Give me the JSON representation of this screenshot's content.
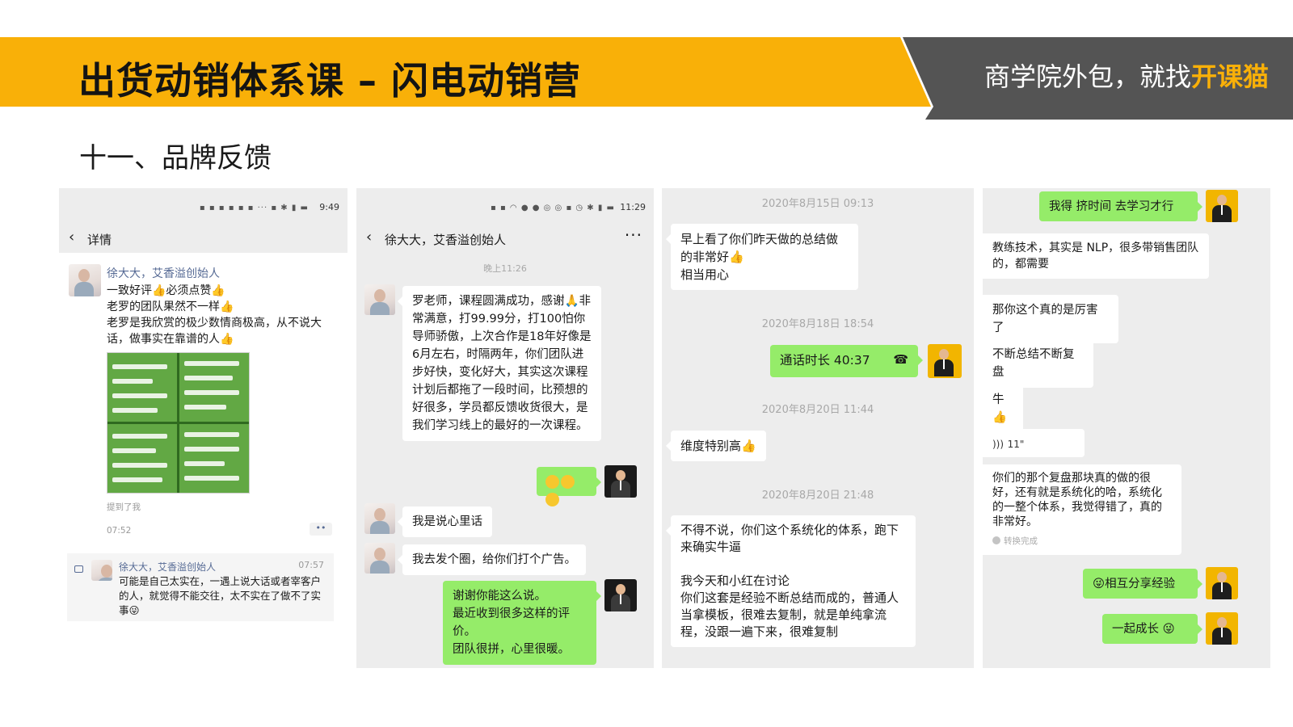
{
  "header": {
    "title": "出货动销体系课 – 闪电动销营",
    "slogan_prefix": "商学院外包，就找",
    "slogan_brand": "开课猫",
    "colors": {
      "yellow": "#f9b008",
      "gray": "#545454"
    }
  },
  "section_title": "十一、品牌反馈",
  "panel1": {
    "status_time": "9:49",
    "nav_title": "详情",
    "poster_name": "徐大大，艾香溢创始人",
    "post_lines": [
      "一致好评👍必须点赞👍",
      "老罗的团队果然不一样👍",
      "老罗是我欣赏的极少数情商极高，从不说大话，做事实在靠谱的人👍"
    ],
    "mention": "提到了我",
    "post_time": "07:52",
    "more_dots": "••",
    "comment": {
      "name": "徐大大，艾香溢创始人",
      "time": "07:57",
      "text": "可能是自己太实在，一遇上说大话或者宰客户的人，就觉得不能交往，太不实在了做不了实事😜"
    }
  },
  "panel2": {
    "status_time": "11:29",
    "nav_title": "徐大大，艾香溢创始人",
    "nav_more": "···",
    "time_label": "晚上11:26",
    "msg1": "罗老师，课程圆满成功，感谢🙏非常满意，打99.99分，打100怕你导师骄傲，上次合作是18年好像是6月左右，时隔两年，你们团队进步好快，变化好大，其实这次课程计划后都拖了一段时间，比预想的好很多，学员都反馈收货很大，是我们学习线上的最好的一次课程。",
    "msg2": "我是说心里话",
    "msg3": "我去发个圈，给你们打个广告。",
    "reply": "谢谢你能这么说。\n最近收到很多这样的评价。\n团队很拼，心里很暖。"
  },
  "panel3": {
    "ts1": "2020年8月15日 09:13",
    "msg1": "早上看了你们昨天做的总结做的非常好👍\n相当用心",
    "ts2": "2020年8月18日 18:54",
    "call": "通话时长 40:37",
    "ts3": "2020年8月20日 11:44",
    "msg2": "维度特别高👍",
    "ts4": "2020年8月20日 21:48",
    "msg3": "不得不说，你们这个系统化的体系，跑下来确实牛逼\n\n我今天和小红在讨论\n你们这套是经验不断总结而成的，普通人当拿模板，很难去复制，就是单纯拿流程，没跟一遍下来，很难复制"
  },
  "panel4": {
    "sent1": "我得 挤时间 去学习才行",
    "msg1": "教练技术，其实是 NLP，很多带销售团队的，都需要",
    "msg2": "那你这个真的是厉害了",
    "msg3": "不断总结不断复盘",
    "msg4": "牛👍",
    "voice_len": "11\"",
    "voice_text": "你们的那个复盘那块真的做的很好，还有就是系统化的哈，系统化的一整个体系，我觉得错了，真的非常好。",
    "transcribed": "转换完成",
    "sent2": "😜相互分享经验",
    "sent3": "一起成长 😜"
  }
}
